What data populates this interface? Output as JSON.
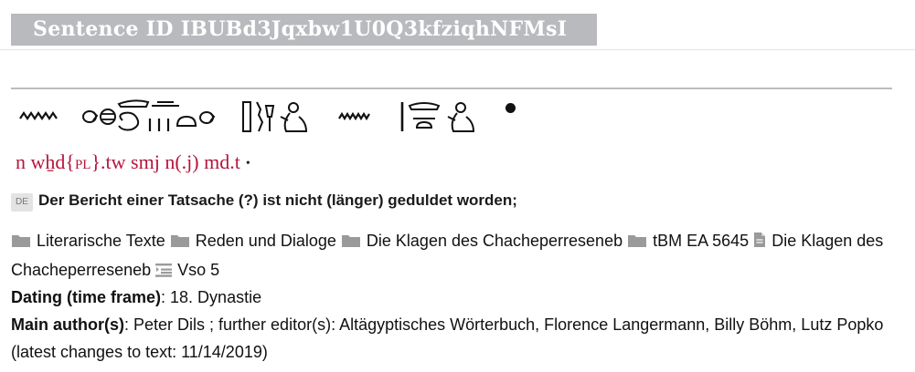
{
  "title": "Sentence ID IBUBd3Jqxbw1U0Q3kfziqhNFMsI",
  "hieroglyph_icons": [
    "water-ripple-n-icon",
    "whd-group-icon",
    "smj-group-icon",
    "n-ripple-icon",
    "mdt-group-icon"
  ],
  "transliteration": {
    "before": "n wẖd{",
    "small_caps": "PL",
    "after": "}.tw smj n(.j) md.t",
    "bullet": "•"
  },
  "translation": {
    "lang": "DE",
    "text": "Der Bericht einer Tatsache (?) ist nicht (länger) geduldet worden;"
  },
  "path": [
    {
      "icon": "folder-icon",
      "label": "Literarische Texte"
    },
    {
      "icon": "folder-icon",
      "label": "Reden und Dialoge"
    },
    {
      "icon": "folder-icon",
      "label": "Die Klagen des Chacheperreseneb"
    },
    {
      "icon": "folder-icon",
      "label": "tBM EA 5645"
    },
    {
      "icon": "document-icon",
      "label": "Die Klagen des Chacheperreseneb"
    },
    {
      "icon": "text-lines-icon",
      "label": "Vso 5"
    }
  ],
  "dating": {
    "label": "Dating (time frame)",
    "value": ": 18. Dynastie"
  },
  "authors": {
    "label": "Main author(s)",
    "value": ": Peter Dils ; further editor(s): Altägyptisches Wörterbuch, Florence Langermann, Billy Böhm, Lutz Popko (latest changes to text: 11/14/2019)"
  }
}
